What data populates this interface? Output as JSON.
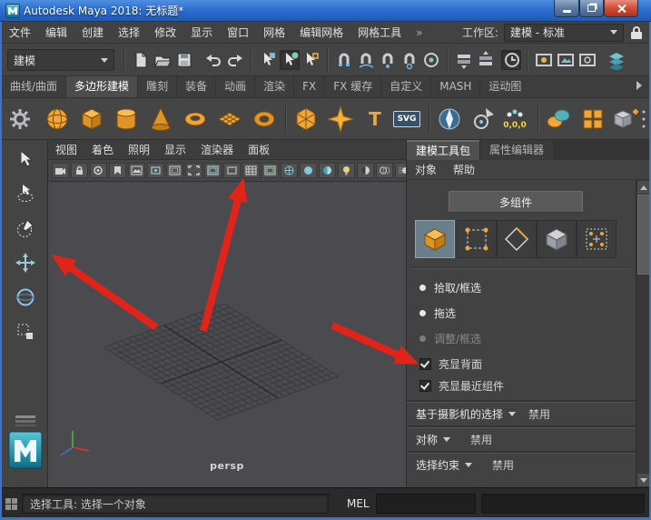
{
  "window": {
    "title": "Autodesk Maya 2018: 无标题*"
  },
  "menubar": {
    "items": [
      "文件",
      "编辑",
      "创建",
      "选择",
      "修改",
      "显示",
      "窗口",
      "网格",
      "编辑网格",
      "网格工具"
    ],
    "overflow_glyph": "»",
    "workspace_label": "工作区:",
    "workspace_value": "建模 - 标准"
  },
  "toolbar": {
    "menu_set": "建模"
  },
  "shelf": {
    "tabs": [
      "曲线/曲面",
      "多边形建模",
      "雕刻",
      "装备",
      "动画",
      "渲染",
      "FX",
      "FX 缓存",
      "自定义",
      "MASH",
      "运动图"
    ],
    "active_tab": "多边形建模",
    "type_tool_text": "T",
    "svg_tool_text": "SVG",
    "origin_tool_text": "0,0,0"
  },
  "viewport": {
    "menus": [
      "视图",
      "着色",
      "照明",
      "显示",
      "渲染器",
      "面板"
    ],
    "camera_label": "persp"
  },
  "right_panel": {
    "tabs": [
      "建模工具包",
      "属性编辑器"
    ],
    "active_tab": "建模工具包",
    "menus": [
      "对象",
      "帮助"
    ],
    "multi_component": "多组件",
    "radios": [
      {
        "label": "拾取/框选",
        "selected": true,
        "disabled": false
      },
      {
        "label": "拖选",
        "selected": false,
        "disabled": false
      },
      {
        "label": "调整/框选",
        "selected": false,
        "disabled": true
      }
    ],
    "checkboxes": [
      {
        "label": "亮显背面",
        "checked": true
      },
      {
        "label": "亮显最近组件",
        "checked": true
      }
    ],
    "sections": [
      {
        "label": "基于摄影机的选择",
        "value": "禁用"
      },
      {
        "label": "对称",
        "value": "禁用"
      },
      {
        "label": "选择约束",
        "value": "禁用"
      }
    ]
  },
  "statusbar": {
    "help_text": "选择工具: 选择一个对象",
    "mel_label": "MEL"
  },
  "colors": {
    "titlebar_blue": "#2d6fd2",
    "icon_orange": "#f0a636",
    "annotation_red": "#e2231a",
    "highlight_teal": "#6b7f8a"
  }
}
